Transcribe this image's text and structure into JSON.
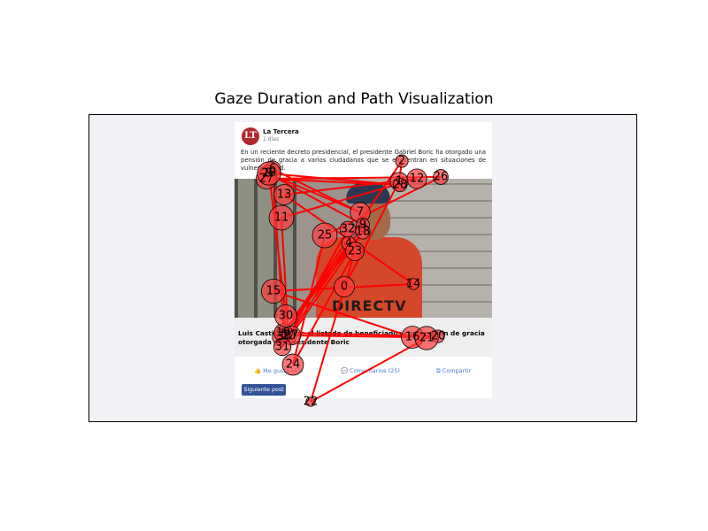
{
  "chart_data": {
    "type": "scatter",
    "title": "Gaze Duration and Path Visualization",
    "xlim": [
      0,
      620
    ],
    "ylim": [
      0,
      348
    ],
    "y_inverted": true,
    "grid": false,
    "marker_color": "#ff3c3c",
    "path_color": "#ff0000",
    "fixations": [
      {
        "id": 0,
        "x": 288,
        "y": 194,
        "duration": 420
      },
      {
        "id": 1,
        "x": 350,
        "y": 75,
        "duration": 300
      },
      {
        "id": 2,
        "x": 353,
        "y": 52,
        "duration": 100
      },
      {
        "id": 3,
        "x": 216,
        "y": 251,
        "duration": 220
      },
      {
        "id": 4,
        "x": 293,
        "y": 145,
        "duration": 140
      },
      {
        "id": 5,
        "x": 220,
        "y": 248,
        "duration": 160
      },
      {
        "id": 6,
        "x": 207,
        "y": 61,
        "duration": 220
      },
      {
        "id": 7,
        "x": 306,
        "y": 110,
        "duration": 400
      },
      {
        "id": 8,
        "x": 202,
        "y": 66,
        "duration": 250
      },
      {
        "id": 9,
        "x": 309,
        "y": 124,
        "duration": 120
      },
      {
        "id": 10,
        "x": 225,
        "y": 250,
        "duration": 200
      },
      {
        "id": 11,
        "x": 217,
        "y": 116,
        "duration": 700
      },
      {
        "id": 12,
        "x": 370,
        "y": 72,
        "duration": 380
      },
      {
        "id": 13,
        "x": 220,
        "y": 90,
        "duration": 420
      },
      {
        "id": 14,
        "x": 366,
        "y": 191,
        "duration": 60
      },
      {
        "id": 15,
        "x": 208,
        "y": 199,
        "duration": 650
      },
      {
        "id": 16,
        "x": 365,
        "y": 251,
        "duration": 520
      },
      {
        "id": 17,
        "x": 228,
        "y": 249,
        "duration": 350
      },
      {
        "id": 18,
        "x": 309,
        "y": 132,
        "duration": 150
      },
      {
        "id": 19,
        "x": 219,
        "y": 246,
        "duration": 300
      },
      {
        "id": 20,
        "x": 394,
        "y": 250,
        "duration": 100
      },
      {
        "id": 21,
        "x": 381,
        "y": 252,
        "duration": 600
      },
      {
        "id": 22,
        "x": 250,
        "y": 324,
        "duration": 30
      },
      {
        "id": 23,
        "x": 300,
        "y": 154,
        "duration": 320
      },
      {
        "id": 24,
        "x": 230,
        "y": 282,
        "duration": 460
      },
      {
        "id": 25,
        "x": 266,
        "y": 136,
        "duration": 700
      },
      {
        "id": 26,
        "x": 397,
        "y": 70,
        "duration": 170
      },
      {
        "id": 27,
        "x": 200,
        "y": 72,
        "duration": 420
      },
      {
        "id": 28,
        "x": 351,
        "y": 79,
        "duration": 130
      },
      {
        "id": 29,
        "x": 203,
        "y": 66,
        "duration": 600
      },
      {
        "id": 30,
        "x": 222,
        "y": 227,
        "duration": 520
      },
      {
        "id": 31,
        "x": 218,
        "y": 262,
        "duration": 260
      },
      {
        "id": 32,
        "x": 292,
        "y": 129,
        "duration": 200
      }
    ]
  },
  "stimulus": {
    "logo_text": "LT",
    "page_name": "La Tercera",
    "post_time": "1 días",
    "body": "En un reciente decreto presidencial, el presidente Gabriel Boric ha otorgado una pensión de gracia a varios ciudadanos que se encuentran en situaciones de vulnerabilidad.",
    "photo_logo": "DIRECTV",
    "headline": "Luis Castillo entre el listado de beneficiados con pensión de gracia otorgada por presidente Boric",
    "like_label": "👍 Me gusta (41)",
    "comment_label": "💬 Comentarios (25)",
    "share_label": "⧉ Compartir",
    "next_button": "Siguiente post"
  }
}
